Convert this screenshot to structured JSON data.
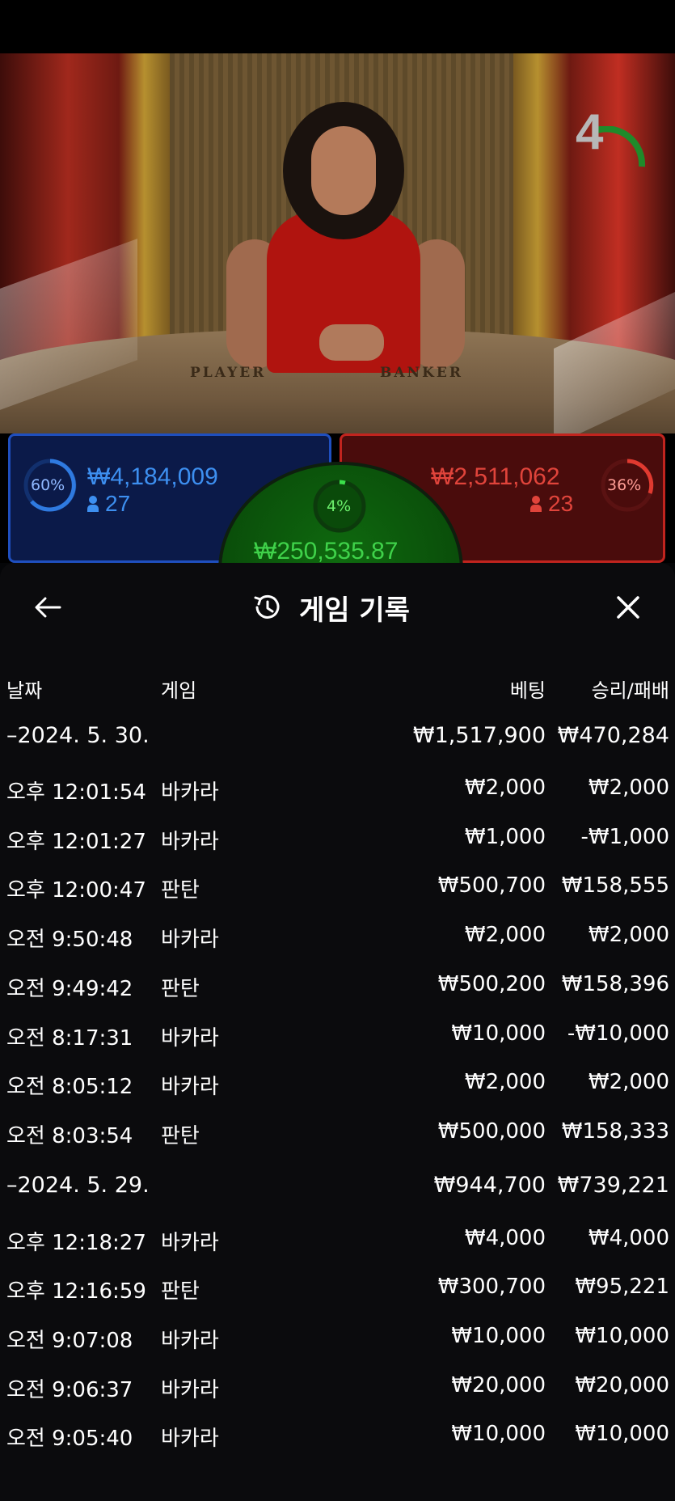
{
  "stream": {
    "countdown": "4",
    "table_labels": {
      "player": "PLAYER",
      "banker": "BANKER"
    }
  },
  "betting": {
    "player": {
      "percent": "60%",
      "amount": "₩4,184,009",
      "players": "27"
    },
    "banker": {
      "percent": "36%",
      "amount": "₩2,511,062",
      "players": "23"
    },
    "tie": {
      "percent": "4%",
      "amount": "₩250,535.87"
    }
  },
  "history": {
    "title": "게임 기록",
    "columns": {
      "date": "날짜",
      "game": "게임",
      "bet": "베팅",
      "result": "승리/패배"
    },
    "groups": [
      {
        "date": "–2024. 5. 30.",
        "bet_total": "₩1,517,900",
        "result_total": "₩470,284",
        "rows": [
          {
            "time": "오후 12:01:54",
            "game": "바카라",
            "bet": "₩2,000",
            "result": "₩2,000"
          },
          {
            "time": "오후 12:01:27",
            "game": "바카라",
            "bet": "₩1,000",
            "result": "-₩1,000"
          },
          {
            "time": "오후 12:00:47",
            "game": "판탄",
            "bet": "₩500,700",
            "result": "₩158,555"
          },
          {
            "time": "오전 9:50:48",
            "game": "바카라",
            "bet": "₩2,000",
            "result": "₩2,000"
          },
          {
            "time": "오전 9:49:42",
            "game": "판탄",
            "bet": "₩500,200",
            "result": "₩158,396"
          },
          {
            "time": "오전 8:17:31",
            "game": "바카라",
            "bet": "₩10,000",
            "result": "-₩10,000"
          },
          {
            "time": "오전 8:05:12",
            "game": "바카라",
            "bet": "₩2,000",
            "result": "₩2,000"
          },
          {
            "time": "오전 8:03:54",
            "game": "판탄",
            "bet": "₩500,000",
            "result": "₩158,333"
          }
        ]
      },
      {
        "date": "–2024. 5. 29.",
        "bet_total": "₩944,700",
        "result_total": "₩739,221",
        "rows": [
          {
            "time": "오후 12:18:27",
            "game": "바카라",
            "bet": "₩4,000",
            "result": "₩4,000"
          },
          {
            "time": "오후 12:16:59",
            "game": "판탄",
            "bet": "₩300,700",
            "result": "₩95,221"
          },
          {
            "time": "오전 9:07:08",
            "game": "바카라",
            "bet": "₩10,000",
            "result": "₩10,000"
          },
          {
            "time": "오전 9:06:37",
            "game": "바카라",
            "bet": "₩20,000",
            "result": "₩20,000"
          },
          {
            "time": "오전 9:05:40",
            "game": "바카라",
            "bet": "₩10,000",
            "result": "₩10,000"
          }
        ]
      }
    ]
  }
}
